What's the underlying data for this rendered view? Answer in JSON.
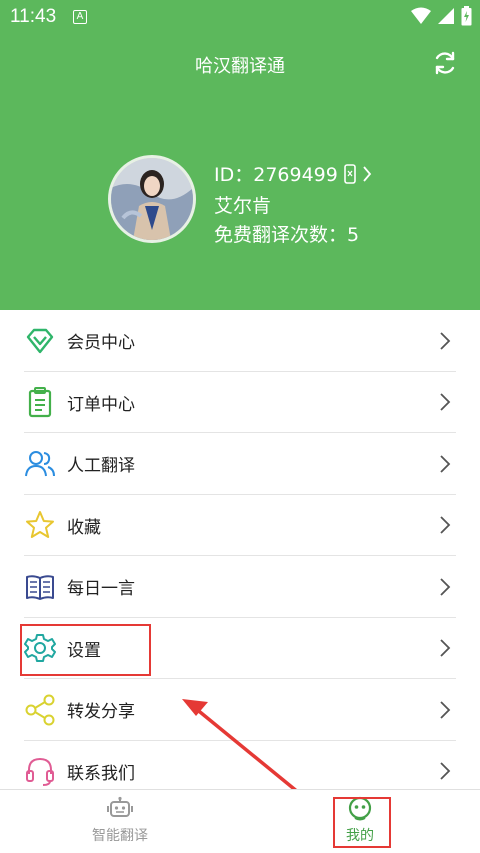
{
  "status_bar": {
    "time": "11:43",
    "notification_letter": "A"
  },
  "header": {
    "title": "哈汉翻译通",
    "user_id": "ID：2769499",
    "user_name": "艾尔肯",
    "free_count_label": "免费翻译次数：5"
  },
  "menu": {
    "items": [
      {
        "label": "会员中心",
        "icon": "diamond-icon",
        "color": "#2fb56a"
      },
      {
        "label": "订单中心",
        "icon": "clipboard-icon",
        "color": "#43b04a"
      },
      {
        "label": "人工翻译",
        "icon": "users-icon",
        "color": "#2b8de0"
      },
      {
        "label": "收藏",
        "icon": "star-icon",
        "color": "#e8c630"
      },
      {
        "label": "每日一言",
        "icon": "book-icon",
        "color": "#3a4a90"
      },
      {
        "label": "设置",
        "icon": "gear-icon",
        "color": "#20a7a0"
      },
      {
        "label": "转发分享",
        "icon": "share-icon",
        "color": "#d9d230"
      },
      {
        "label": "联系我们",
        "icon": "headset-icon",
        "color": "#e05c94"
      }
    ]
  },
  "tabbar": {
    "tabs": [
      {
        "label": "智能翻译",
        "icon": "robot-icon",
        "active": false
      },
      {
        "label": "我的",
        "icon": "smiley-icon",
        "active": true
      }
    ]
  },
  "colors": {
    "brand_green": "#5cb85c",
    "annotation_red": "#e53935"
  }
}
